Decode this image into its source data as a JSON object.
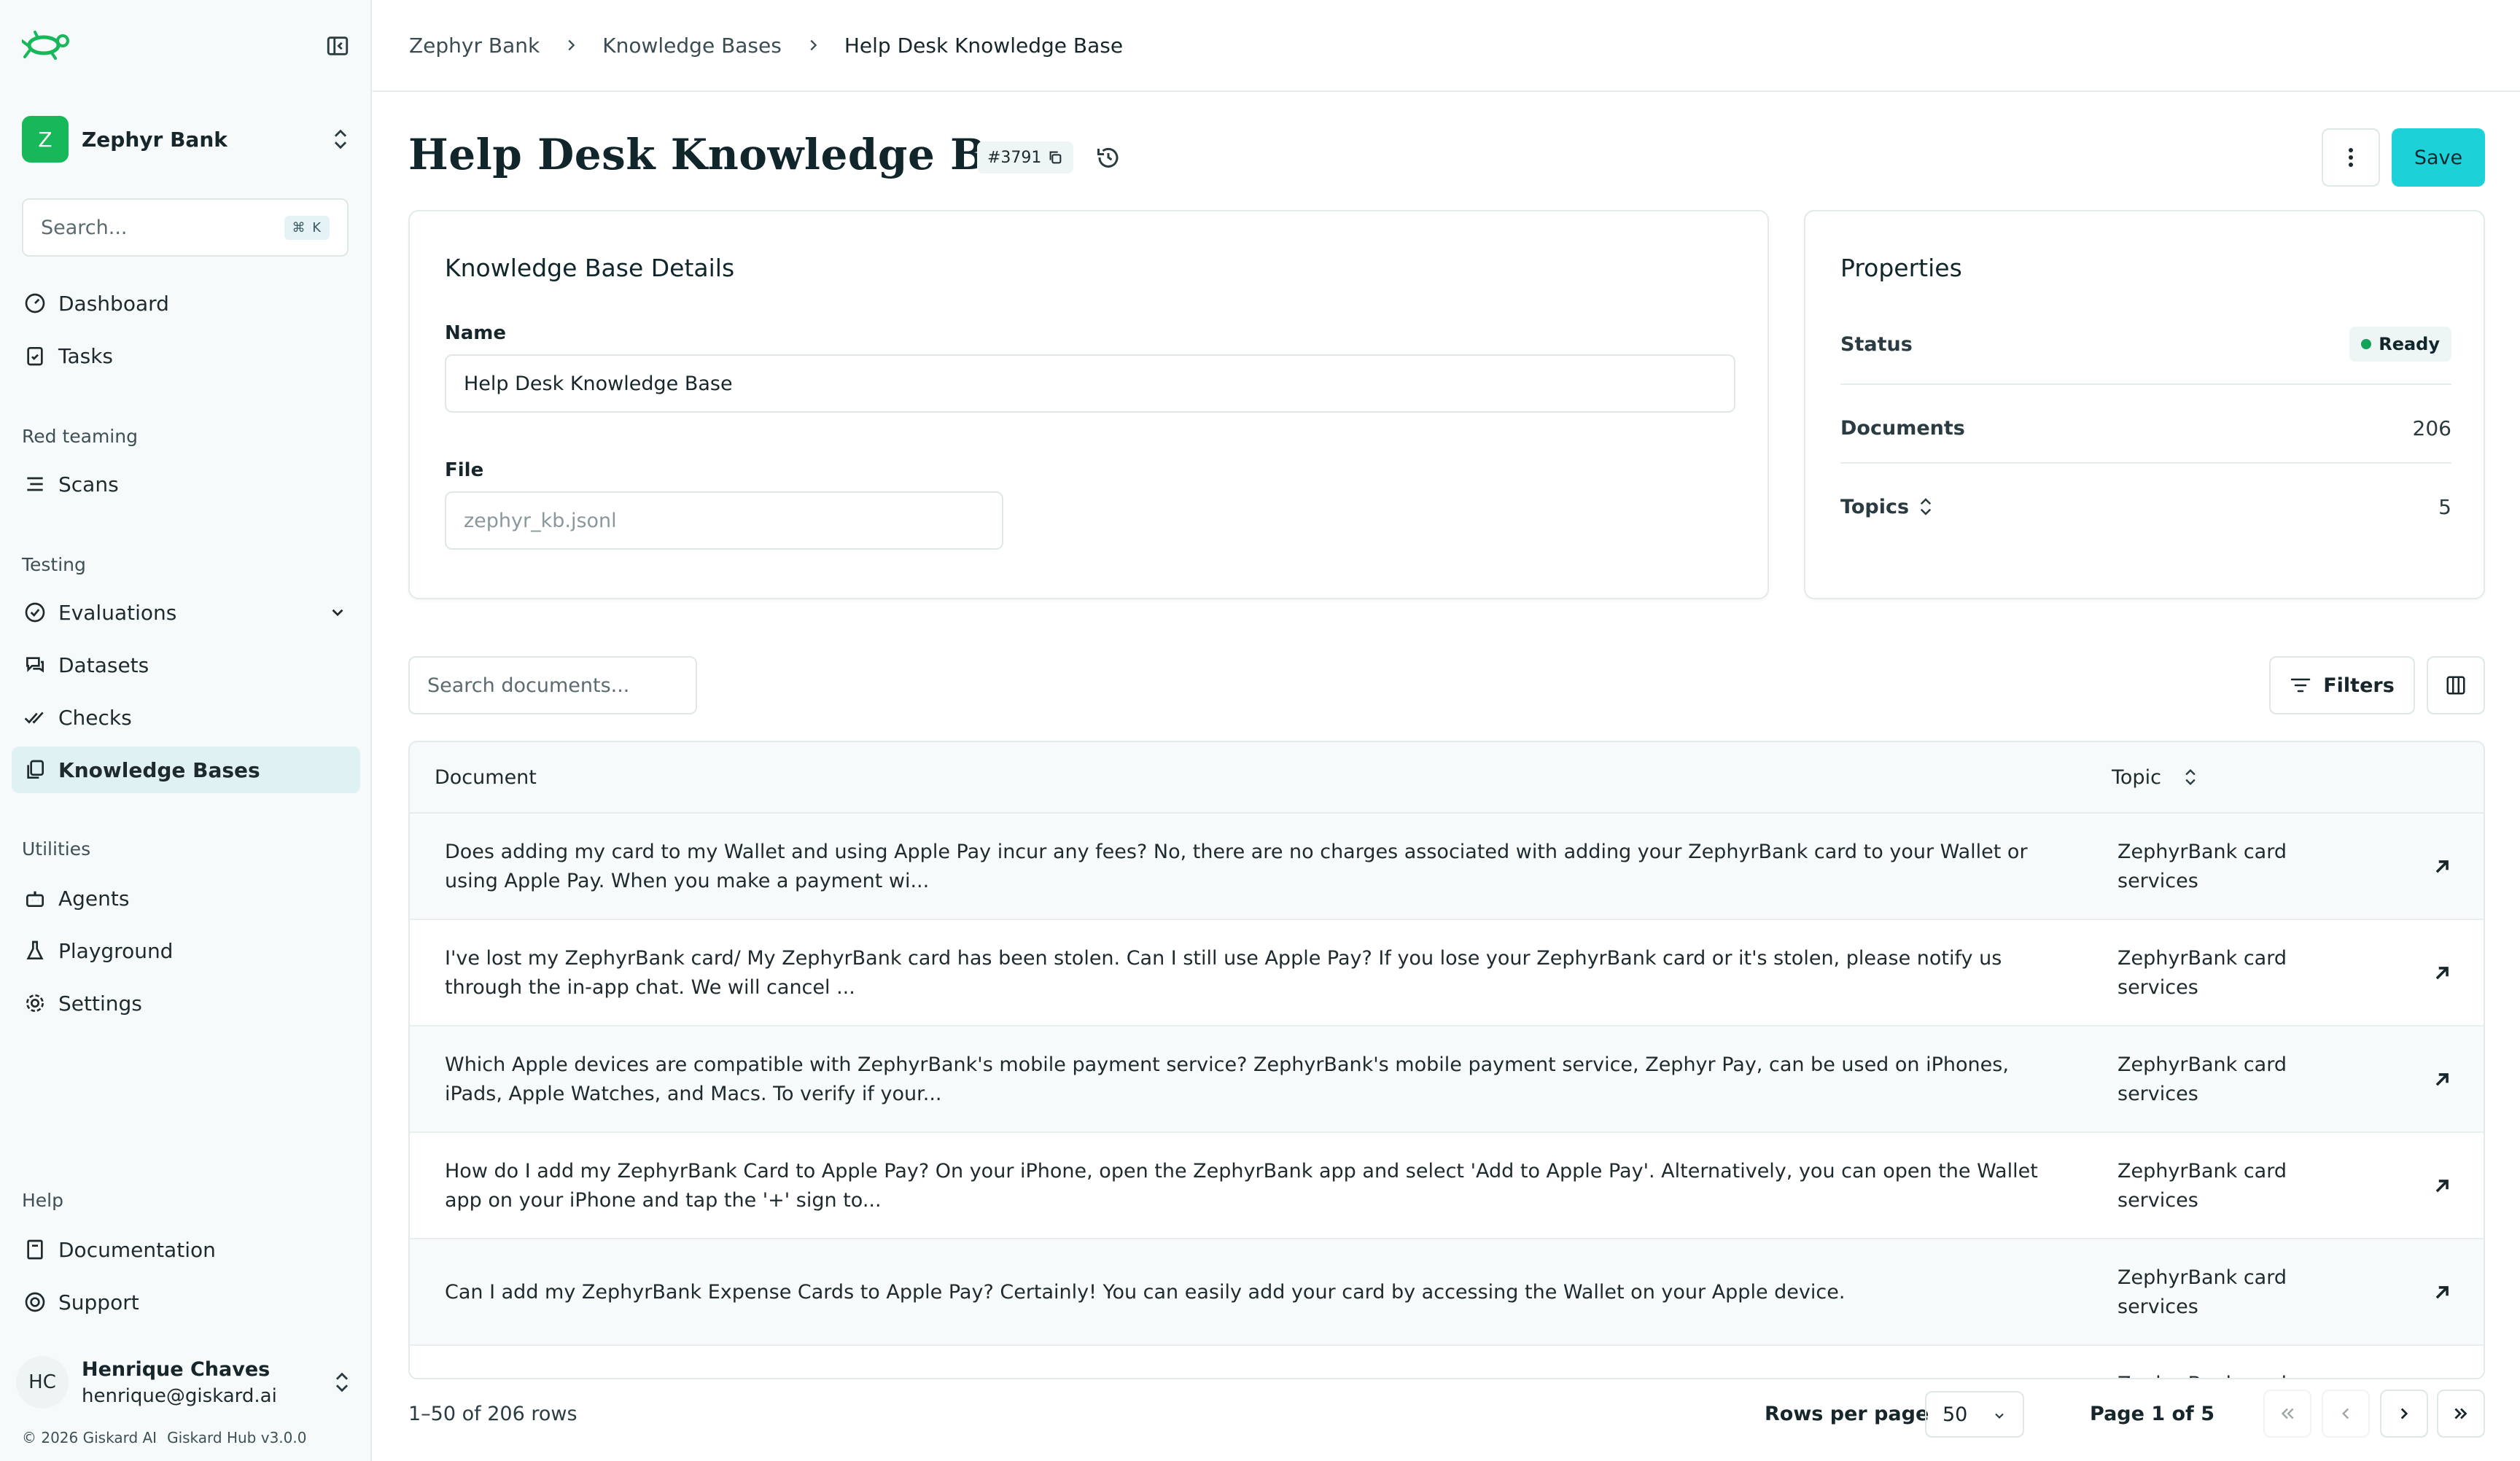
{
  "sidebar": {
    "org": {
      "initial": "Z",
      "name": "Zephyr Bank"
    },
    "search": {
      "placeholder": "Search...",
      "shortcut": "⌘ K"
    },
    "top_items": [
      {
        "label": "Dashboard",
        "icon": "dashboard-icon"
      },
      {
        "label": "Tasks",
        "icon": "clipboard-icon"
      }
    ],
    "sections": {
      "red_teaming": {
        "title": "Red teaming",
        "items": [
          {
            "label": "Scans",
            "icon": "scan-icon"
          }
        ]
      },
      "testing": {
        "title": "Testing",
        "items": [
          {
            "label": "Evaluations",
            "icon": "check-circle-icon"
          },
          {
            "label": "Datasets",
            "icon": "chat-icon"
          },
          {
            "label": "Checks",
            "icon": "double-check-icon"
          },
          {
            "label": "Knowledge Bases",
            "icon": "copy-icon",
            "active": true
          }
        ]
      },
      "utilities": {
        "title": "Utilities",
        "items": [
          {
            "label": "Agents",
            "icon": "bot-icon"
          },
          {
            "label": "Playground",
            "icon": "flask-icon"
          },
          {
            "label": "Settings",
            "icon": "gear-icon"
          }
        ]
      },
      "help": {
        "title": "Help",
        "items": [
          {
            "label": "Documentation",
            "icon": "book-icon"
          },
          {
            "label": "Support",
            "icon": "lifebuoy-icon"
          }
        ]
      }
    },
    "user": {
      "initials": "HC",
      "name": "Henrique Chaves",
      "email": "henrique@giskard.ai"
    },
    "footer": {
      "copyright": "© 2026 Giskard AI",
      "version": "Giskard Hub v3.0.0"
    }
  },
  "breadcrumb": [
    "Zephyr Bank",
    "Knowledge Bases",
    "Help Desk Knowledge Base"
  ],
  "header": {
    "title": "Help Desk Knowledge Base",
    "id": "#3791",
    "save_label": "Save"
  },
  "details": {
    "title": "Knowledge Base Details",
    "name_label": "Name",
    "name_value": "Help Desk Knowledge Base",
    "file_label": "File",
    "file_placeholder": "zephyr_kb.jsonl"
  },
  "properties": {
    "title": "Properties",
    "status_label": "Status",
    "status_value": "Ready",
    "documents_label": "Documents",
    "documents_value": "206",
    "topics_label": "Topics",
    "topics_value": "5"
  },
  "toolbar": {
    "search_placeholder": "Search documents...",
    "filters_label": "Filters"
  },
  "table": {
    "columns": [
      "Document",
      "Topic"
    ],
    "rows": [
      {
        "document": "Does adding my card to my Wallet and using Apple Pay incur any fees? No, there are no charges associated with adding your ZephyrBank card to your Wallet or using Apple Pay. When you make a payment wi...",
        "topic": "ZephyrBank card services"
      },
      {
        "document": "I've lost my ZephyrBank card/ My ZephyrBank card has been stolen. Can I still use Apple Pay? If you lose your ZephyrBank card or it's stolen, please notify us through the in-app chat. We will cancel ...",
        "topic": "ZephyrBank card services"
      },
      {
        "document": "Which Apple devices are compatible with ZephyrBank's mobile payment service? ZephyrBank's mobile payment service, Zephyr Pay, can be used on iPhones, iPads, Apple Watches, and Macs. To verify if your...",
        "topic": "ZephyrBank card services"
      },
      {
        "document": "How do I add my ZephyrBank Card to Apple Pay? On your iPhone, open the ZephyrBank app and select 'Add to Apple Pay'. Alternatively, you can open the Wallet app on your iPhone and tap the '+' sign to...",
        "topic": "ZephyrBank card services"
      },
      {
        "document": "Can I add my ZephyrBank Expense Cards to Apple Pay? Certainly! You can easily add your card by accessing the Wallet on your Apple device.",
        "topic": "ZephyrBank card services"
      },
      {
        "document": "",
        "topic": "ZephyrBank card services"
      }
    ]
  },
  "pagination": {
    "rows_count": "1–50 of 206 rows",
    "rows_per_page_label": "Rows per page",
    "rows_per_page_value": "50",
    "page_label": "Page 1 of 5"
  },
  "colors": {
    "accent": "#1cd1d8",
    "brand_green": "#17b85a",
    "active_nav": "#dff1f3",
    "status_ready": "#12a35a"
  }
}
